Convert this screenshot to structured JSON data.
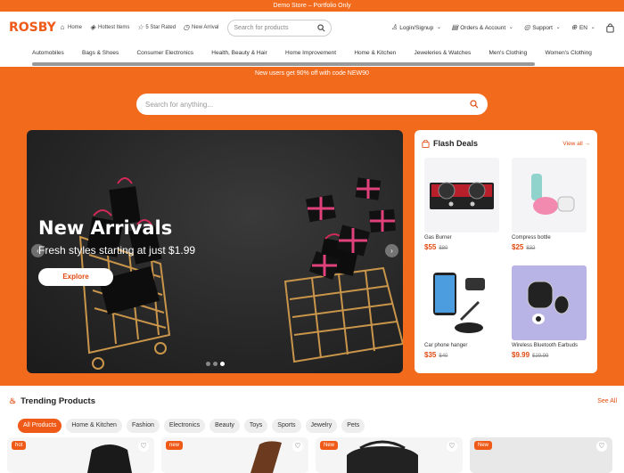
{
  "topbar": {
    "text": "Demo Store – Portfolio Only"
  },
  "header": {
    "logo": "ROSBY",
    "quicklinks": [
      {
        "label": "Home",
        "icon": "home-icon"
      },
      {
        "label": "Hottest Items",
        "icon": "tag-icon"
      },
      {
        "label": "5 Star Rated",
        "icon": "star-icon"
      },
      {
        "label": "New Arrival",
        "icon": "clock-icon"
      }
    ],
    "search_placeholder": "Search for products",
    "account": "Login/Signup",
    "orders": "Orders & Account",
    "support": "Support",
    "lang": "EN"
  },
  "categories": [
    "Automobiles",
    "Bags & Shoes",
    "Consumer Electronics",
    "Health, Beauty & Hair",
    "Home Improvement",
    "Home & Kitchen",
    "Jeweleries & Watches",
    "Men's Clothing",
    "Women's Clothing"
  ],
  "promo": "New users get 90% off with code NEW90",
  "main_search_placeholder": "Search for anything...",
  "hero": {
    "title": "New Arrivals",
    "subtitle": "Fresh styles starting at just $1.99",
    "cta": "Explore",
    "slides": 3,
    "active_slide": 3
  },
  "flash": {
    "title": "Flash Deals",
    "view_all": "View all",
    "items": [
      {
        "name": "Gas Burner",
        "price": "$55",
        "old": "$80"
      },
      {
        "name": "Compress bottle",
        "price": "$25",
        "old": "$32"
      },
      {
        "name": "Car phone hanger",
        "price": "$35",
        "old": "$40"
      },
      {
        "name": "Wireless Bluetooth Earbuds",
        "price": "$9.99",
        "old": "$29.99"
      }
    ]
  },
  "trending": {
    "title": "Trending Products",
    "see_all": "See All",
    "filters": [
      "All Products",
      "Home & Kitchen",
      "Fashion",
      "Electronics",
      "Beauty",
      "Toys",
      "Sports",
      "Jewelry",
      "Pets"
    ],
    "cards": [
      {
        "badge": "hot"
      },
      {
        "badge": "new"
      },
      {
        "badge": "New"
      },
      {
        "badge": "New"
      }
    ]
  },
  "colors": {
    "accent": "#f26a1b",
    "price": "#e14a10"
  }
}
